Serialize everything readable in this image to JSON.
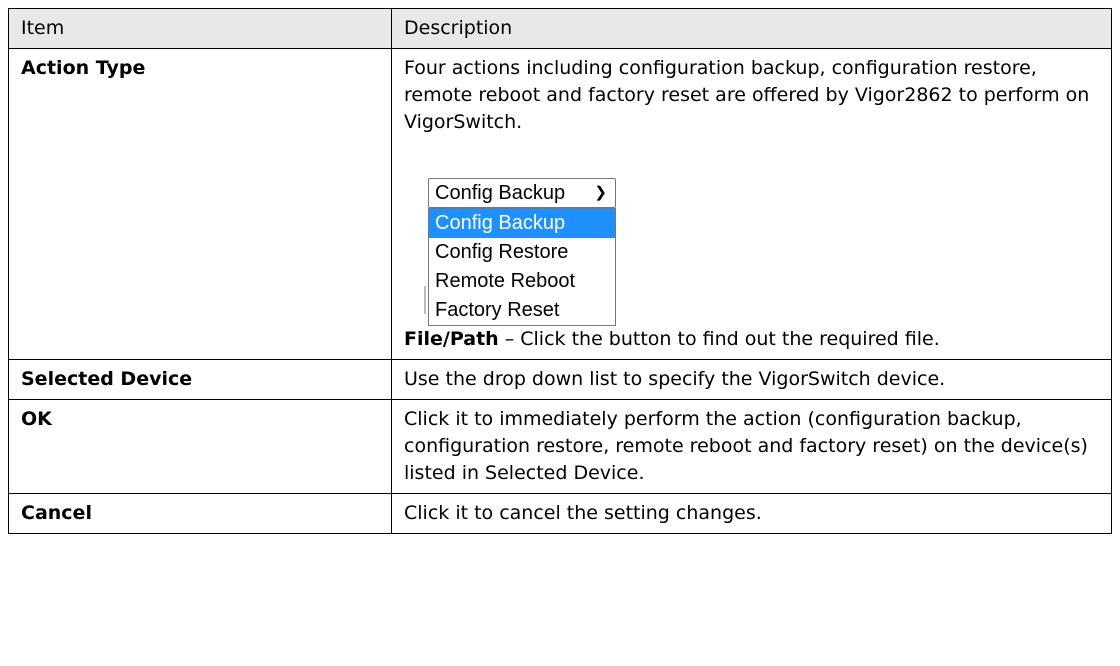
{
  "header": {
    "item": "Item",
    "description": "Description"
  },
  "rows": [
    {
      "item": "Action Type",
      "description": "Four actions including configuration backup, configuration restore, remote reboot and factory reset are offered by Vigor2862 to perform on VigorSwitch.",
      "dropdown": {
        "selected_value": "Config Backup",
        "options": [
          "Config Backup",
          "Config Restore",
          "Remote Reboot",
          "Factory Reset"
        ],
        "highlighted_index": 0
      },
      "file_label": "File/Path",
      "file_text": " – Click the button to find out the required file."
    },
    {
      "item": "Selected Device",
      "description": "Use the drop down list to specify the VigorSwitch device."
    },
    {
      "item": "OK",
      "description": "Click it to immediately perform the action (configuration backup, configuration restore, remote reboot and factory reset) on the device(s) listed in Selected Device."
    },
    {
      "item": "Cancel",
      "description": "Click it to cancel the setting changes."
    }
  ],
  "colors": {
    "highlight": "#1e90ff",
    "header_bg": "#e8e8e8"
  }
}
